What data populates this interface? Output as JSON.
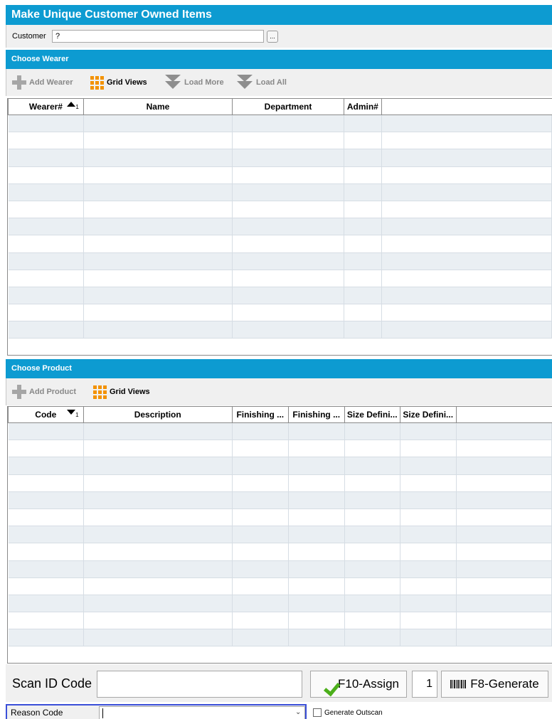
{
  "window": {
    "title": "Make Unique Customer Owned Items"
  },
  "customer": {
    "label": "Customer",
    "value": "?",
    "lookup_button": "..."
  },
  "wearer_section": {
    "header": "Choose Wearer",
    "toolbar": {
      "add": "Add Wearer",
      "grid_views": "Grid Views",
      "load_more": "Load More",
      "load_all": "Load All"
    },
    "columns": [
      "Wearer#",
      "Name",
      "Department",
      "Admin#"
    ],
    "sort": {
      "column": "Wearer#",
      "direction": "ascending",
      "order": "1"
    },
    "rows": []
  },
  "product_section": {
    "header": "Choose Product",
    "toolbar": {
      "add": "Add Product",
      "grid_views": "Grid Views"
    },
    "columns": [
      "Code",
      "Description",
      "Finishing ...",
      "Finishing ...",
      "Size Defini...",
      "Size Defini..."
    ],
    "sort": {
      "column": "Code",
      "direction": "descending",
      "order": "1"
    },
    "rows": []
  },
  "scan": {
    "label": "Scan ID Code",
    "value": "",
    "assign_button": "F10-Assign",
    "quantity": "1",
    "generate_button": "F8-Generate"
  },
  "reason": {
    "label": "Reason Code",
    "value": "",
    "generate_outscan_label": "Generate Outscan",
    "generate_outscan_checked": false
  },
  "colors": {
    "header_blue": "#0d9bd1",
    "grid_icon_orange": "#f39200",
    "check_green": "#4caf1b",
    "focus_outline": "#3a4fd8"
  },
  "icons": {
    "add": "plus-icon",
    "grid_views": "grid-icon",
    "load_more": "chevron-double-down-icon",
    "load_all": "chevron-double-down-icon",
    "assign": "check-icon",
    "generate": "barcode-icon"
  }
}
